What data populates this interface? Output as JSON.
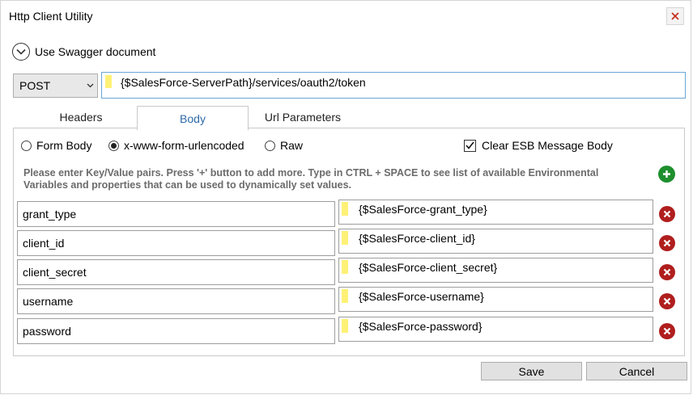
{
  "window": {
    "title": "Http Client Utility"
  },
  "swagger": {
    "label": "Use Swagger document"
  },
  "request": {
    "method": "POST",
    "url": "{$SalesForce-ServerPath}/services/oauth2/token"
  },
  "tabs": [
    {
      "label": "Headers"
    },
    {
      "label": "Body",
      "active": true
    },
    {
      "label": "Url Parameters"
    }
  ],
  "body": {
    "radios": [
      {
        "label": "Form Body",
        "selected": false
      },
      {
        "label": "x-www-form-urlencoded",
        "selected": true
      },
      {
        "label": "Raw",
        "selected": false
      }
    ],
    "clear_label": "Clear ESB Message Body",
    "clear_checked": true,
    "hint": "Please enter Key/Value pairs. Press '+' button to add more. Type in CTRL + SPACE to see list of available Environmental Variables and properties that can be used to dynamically set values.",
    "pairs": [
      {
        "key": "grant_type",
        "value": "{$SalesForce-grant_type}"
      },
      {
        "key": "client_id",
        "value": "{$SalesForce-client_id}"
      },
      {
        "key": "client_secret",
        "value": "{$SalesForce-client_secret}"
      },
      {
        "key": "username",
        "value": "{$SalesForce-username}"
      },
      {
        "key": "password",
        "value": "{$SalesForce-password}"
      }
    ]
  },
  "buttons": {
    "save": "Save",
    "cancel": "Cancel"
  },
  "colors": {
    "accent": "#2e6aa8",
    "add": "#1e8f2e",
    "delete": "#b01e1e",
    "marker": "#fff176"
  },
  "icons": {
    "close": "close-icon",
    "expand": "chevron-down-icon",
    "add": "plus-icon",
    "delete": "x-icon"
  }
}
